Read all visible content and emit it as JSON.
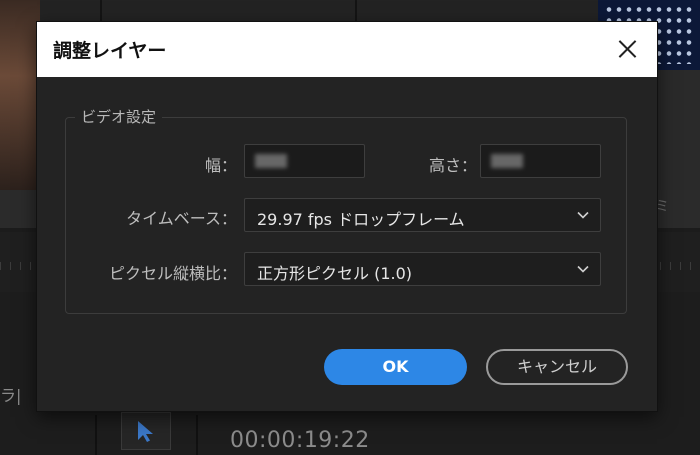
{
  "background": {
    "side_text": "ラ|",
    "timecode": "00:00:19:22",
    "right_col_text": "ミ"
  },
  "dialog": {
    "title": "調整レイヤー",
    "video_settings": {
      "legend": "ビデオ設定",
      "width_label": "幅：",
      "height_label": "高さ：",
      "timebase_label": "タイムベース：",
      "timebase_value": "29.97  fps ドロップフレーム",
      "par_label": "ピクセル縦横比：",
      "par_value": "正方形ピクセル (1.0)"
    },
    "ok_label": "OK",
    "cancel_label": "キャンセル"
  },
  "colors": {
    "accent": "#2d87e6",
    "dialog_bg": "#232323",
    "titlebar_bg": "#ffffff"
  },
  "icons": [
    "close-icon",
    "chevron-down-icon",
    "selection-tool-icon"
  ]
}
